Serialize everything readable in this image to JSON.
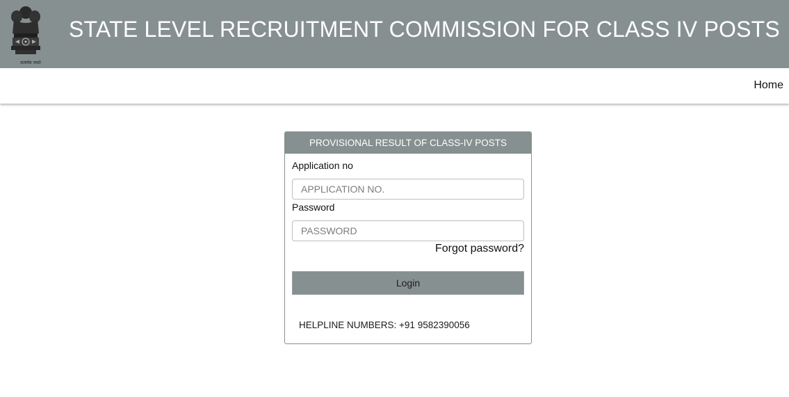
{
  "header": {
    "title": "STATE LEVEL RECRUITMENT COMMISSION FOR CLASS IV POSTS",
    "emblem_icon": "national-emblem-icon",
    "motto": "सत्यमेव जयते",
    "background_color": "#879090"
  },
  "nav": {
    "home_label": "Home"
  },
  "login_panel": {
    "heading": "PROVISIONAL RESULT OF CLASS-IV POSTS",
    "application_label": "Application no",
    "application_placeholder": "APPLICATION NO.",
    "application_value": "",
    "password_label": "Password",
    "password_placeholder": "PASSWORD",
    "password_value": "",
    "forgot_label": "Forgot password?",
    "login_label": "Login",
    "helpline": "HELPLINE NUMBERS: +91 9582390056"
  }
}
